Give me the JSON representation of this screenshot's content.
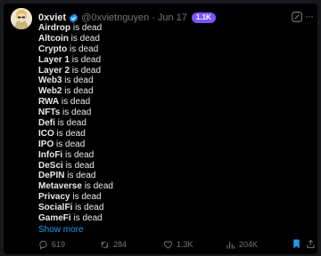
{
  "author": {
    "name": "0xviet",
    "handle": "@0xvietnguyen",
    "separator": "·",
    "date": "Jun 17",
    "badge": "1.1K"
  },
  "tweet": {
    "lines": [
      {
        "term": "Airdrop",
        "suffix": " is dead"
      },
      {
        "term": "Altcoin",
        "suffix": " is dead"
      },
      {
        "term": "Crypto",
        "suffix": " is dead"
      },
      {
        "term": "Layer 1",
        "suffix": " is dead"
      },
      {
        "term": "Layer 2",
        "suffix": " is dead"
      },
      {
        "term": "Web3",
        "suffix": " is dead"
      },
      {
        "term": "Web2",
        "suffix": " is dead"
      },
      {
        "term": "RWA",
        "suffix": " is dead"
      },
      {
        "term": "NFTs",
        "suffix": " is dead"
      },
      {
        "term": "Defi",
        "suffix": " is dead"
      },
      {
        "term": "ICO",
        "suffix": " is dead"
      },
      {
        "term": "IPO",
        "suffix": " is dead"
      },
      {
        "term": "InfoFi",
        "suffix": " is dead"
      },
      {
        "term": "DeSci",
        "suffix": " is dead"
      },
      {
        "term": "DePIN",
        "suffix": " is dead"
      },
      {
        "term": "Metaverse",
        "suffix": " is dead"
      },
      {
        "term": "Privacy",
        "suffix": " is dead"
      },
      {
        "term": "SocialFi",
        "suffix": " is dead"
      },
      {
        "term": "GameFi",
        "suffix": " is dead"
      }
    ],
    "show_more": "Show more"
  },
  "actions": {
    "replies": "619",
    "reposts": "284",
    "likes": "1.3K",
    "views": "204K"
  },
  "colors": {
    "background": "#000000",
    "text": "#e7e9ea",
    "muted": "#71767b",
    "link": "#1d9bf0",
    "badge": "#7856ff",
    "bookmark": "#1d9bf0"
  },
  "icons": [
    "verified-icon",
    "grok-icon",
    "more-icon",
    "reply-icon",
    "retweet-icon",
    "like-icon",
    "views-icon",
    "bookmark-icon",
    "share-icon"
  ]
}
